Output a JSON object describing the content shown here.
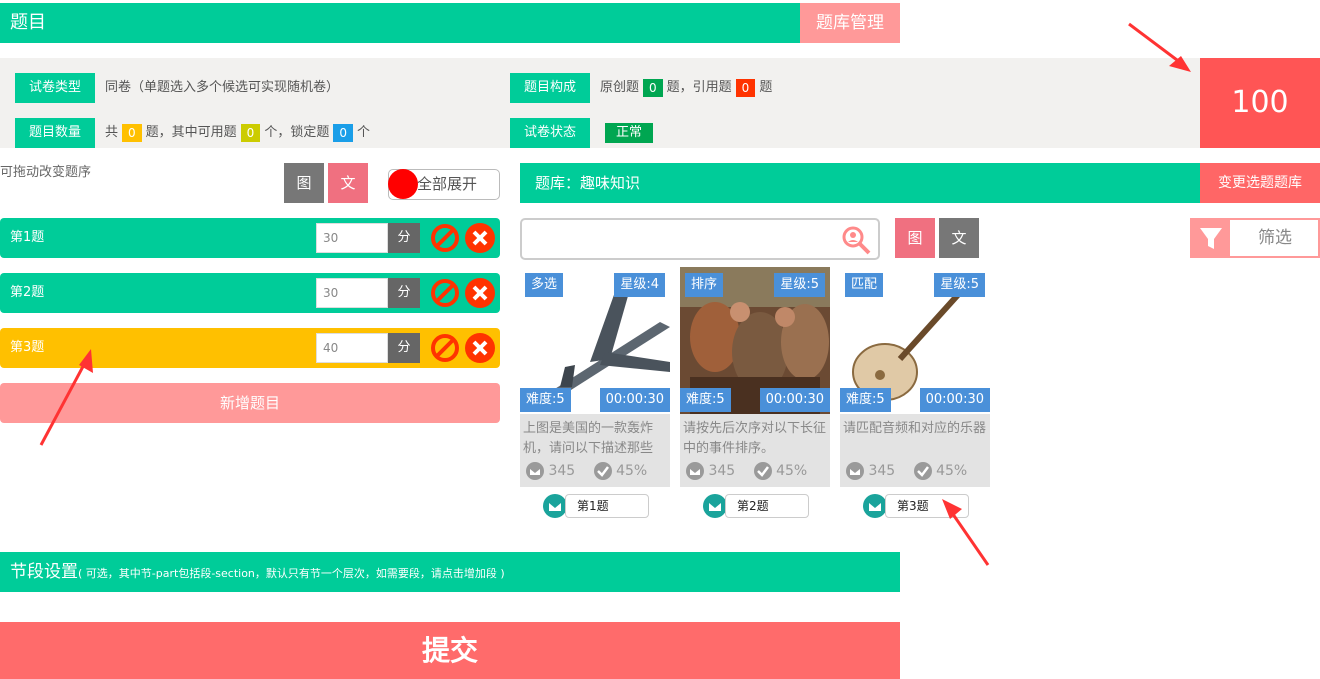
{
  "header": {
    "title": "题目",
    "bank_manage_label": "题库管理"
  },
  "score_total": "100",
  "info": {
    "paper_type_tag": "试卷类型",
    "paper_type_value": "同卷（单题选入多个候选可实现随机卷）",
    "composition_tag": "题目构成",
    "composition_prefix": "原创题",
    "composition_original": "0",
    "composition_mid": "题，引用题",
    "composition_quoted": "0",
    "composition_suffix": "题",
    "count_tag": "题目数量",
    "count_prefix": "共",
    "count_total": "0",
    "count_mid1": "题，其中可用题",
    "count_available": "0",
    "count_mid2": "个，锁定题",
    "count_locked": "0",
    "count_suffix": "个",
    "status_tag": "试卷状态",
    "status_value": "正常"
  },
  "left": {
    "drag_hint": "可拖动改变题序",
    "img_toggle": "图",
    "text_toggle": "文",
    "expand_all": "全部展开",
    "questions": [
      {
        "label": "第1题",
        "score": "30",
        "unit": "分"
      },
      {
        "label": "第2题",
        "score": "30",
        "unit": "分"
      },
      {
        "label": "第3题",
        "score": "40",
        "unit": "分"
      }
    ],
    "add_label": "新增题目"
  },
  "bank": {
    "title": "题库：趣味知识",
    "change_label": "变更选题题库",
    "search_placeholder": "",
    "img_toggle": "图",
    "text_toggle": "文",
    "filter_label": "筛选",
    "cards": [
      {
        "type": "多选",
        "stars": "星级:4",
        "difficulty": "难度:5",
        "time": "00:00:30",
        "desc": "上图是美国的一款轰炸机，请问以下描述那些",
        "views": "345",
        "rate": "45%",
        "pick": "第1题"
      },
      {
        "type": "排序",
        "stars": "星级:5",
        "difficulty": "难度:5",
        "time": "00:00:30",
        "desc": "请按先后次序对以下长征中的事件排序。",
        "views": "345",
        "rate": "45%",
        "pick": "第2题"
      },
      {
        "type": "匹配",
        "stars": "星级:5",
        "difficulty": "难度:5",
        "time": "00:00:30",
        "desc": "请匹配音频和对应的乐器",
        "views": "345",
        "rate": "45%",
        "pick": "第3题"
      }
    ]
  },
  "section": {
    "title": "节段设置",
    "note": "( 可选，其中节-part包括段-section，默认只有节一个层次，如需要段，请点击增加段 )"
  },
  "submit_label": "提交",
  "colors": {
    "accent_green": "#00cc99",
    "salmon": "#ff9999",
    "score_red": "#ff5555",
    "active_yellow": "#ffc000",
    "badge_blue": "#4a90d9"
  }
}
